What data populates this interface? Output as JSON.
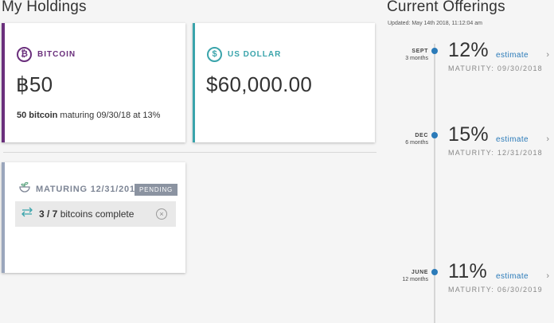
{
  "holdings": {
    "title": "My Holdings",
    "bitcoin": {
      "icon": "bitcoin-icon",
      "icon_glyph": "₿",
      "label": "BITCOIN",
      "amount": "฿50",
      "note_bold": "50 bitcoin",
      "note_rest": "maturing 09/30/18 at 13%",
      "color": "#6a2f7c"
    },
    "usd": {
      "icon": "dollar-icon",
      "icon_glyph": "$",
      "label": "US DOLLAR",
      "amount": "$60,000.00",
      "color": "#3aa4ab"
    },
    "pending": {
      "icon": "seedling-icon",
      "label": "MATURING 12/31/2018",
      "badge": "PENDING",
      "progress_icon": "transfer-icon",
      "progress_bold": "3 / 7",
      "progress_rest": "bitcoins complete",
      "close_glyph": "×"
    }
  },
  "offerings": {
    "title": "Current Offerings",
    "updated": "Updated: May 14th 2018, 11:12:04 am",
    "accent": "#2b7bb9",
    "items": [
      {
        "month": "SEPT",
        "term": "3 months",
        "rate": "12%",
        "estimate": "estimate",
        "maturity": "MATURITY: 09/30/2018"
      },
      {
        "month": "DEC",
        "term": "6 months",
        "rate": "15%",
        "estimate": "estimate",
        "maturity": "MATURITY: 12/31/2018"
      },
      {
        "month": "JUNE",
        "term": "12 months",
        "rate": "11%",
        "estimate": "estimate",
        "maturity": "MATURITY: 06/30/2019"
      }
    ],
    "chevron": "›"
  }
}
